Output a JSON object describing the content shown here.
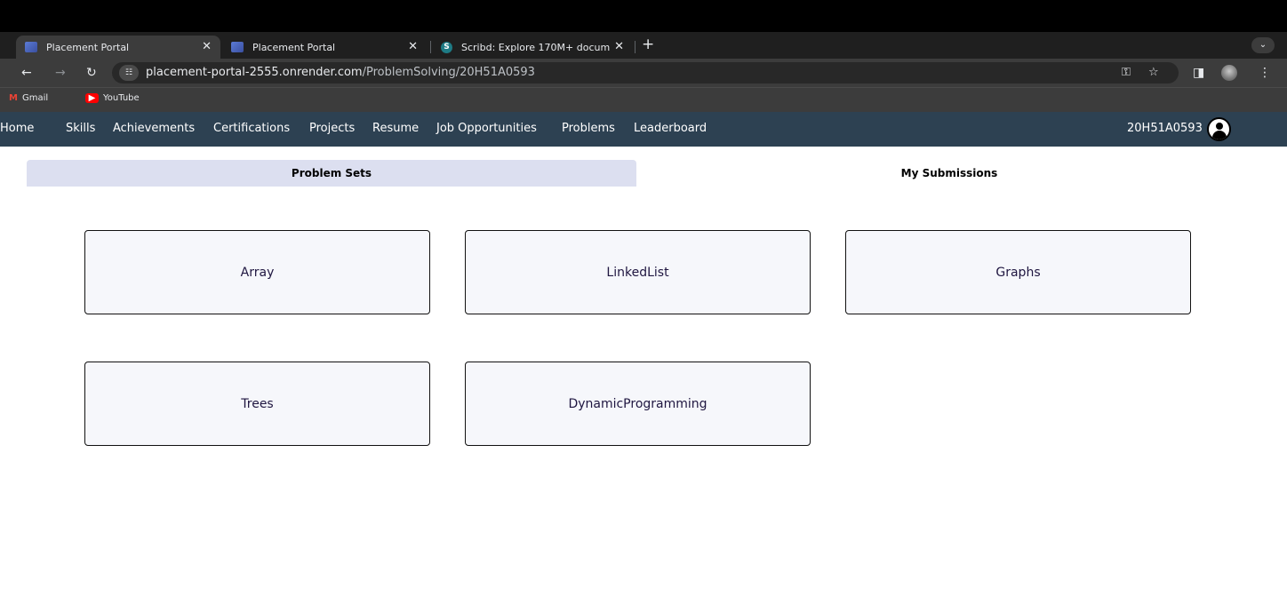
{
  "browser": {
    "tabs": [
      {
        "title": "Placement Portal",
        "active": true
      },
      {
        "title": "Placement Portal",
        "active": false
      },
      {
        "title": "Scribd: Explore 170M+ docum",
        "active": false
      }
    ],
    "new_tab": "+",
    "address": {
      "host": "placement-portal-2555.onrender.com",
      "path": "/ProblemSolving/20H51A0593"
    },
    "bookmarks": [
      {
        "label": "Gmail"
      },
      {
        "label": "YouTube"
      }
    ]
  },
  "nav": {
    "links": [
      "Home",
      "Skills",
      "Achievements",
      "Certifications",
      "Projects",
      "Resume",
      "Job Opportunities",
      "Problems",
      "Leaderboard"
    ],
    "user_id": "20H51A0593"
  },
  "content_tabs": {
    "problem_sets": "Problem Sets",
    "my_submissions": "My Submissions"
  },
  "problem_categories": [
    "Array",
    "LinkedList",
    "Graphs",
    "Trees",
    "DynamicProgramming"
  ],
  "colors": {
    "nav_bg": "#2d4152",
    "active_tab_bg": "#dcdff0",
    "card_bg": "#f6f7fb",
    "card_text": "#1f1640"
  },
  "icons": [
    "back-arrow-icon",
    "forward-arrow-icon",
    "reload-icon",
    "site-info-icon",
    "key-icon",
    "star-icon",
    "side-panel-icon",
    "profile-icon",
    "menu-kebab-icon",
    "user-avatar-icon"
  ]
}
